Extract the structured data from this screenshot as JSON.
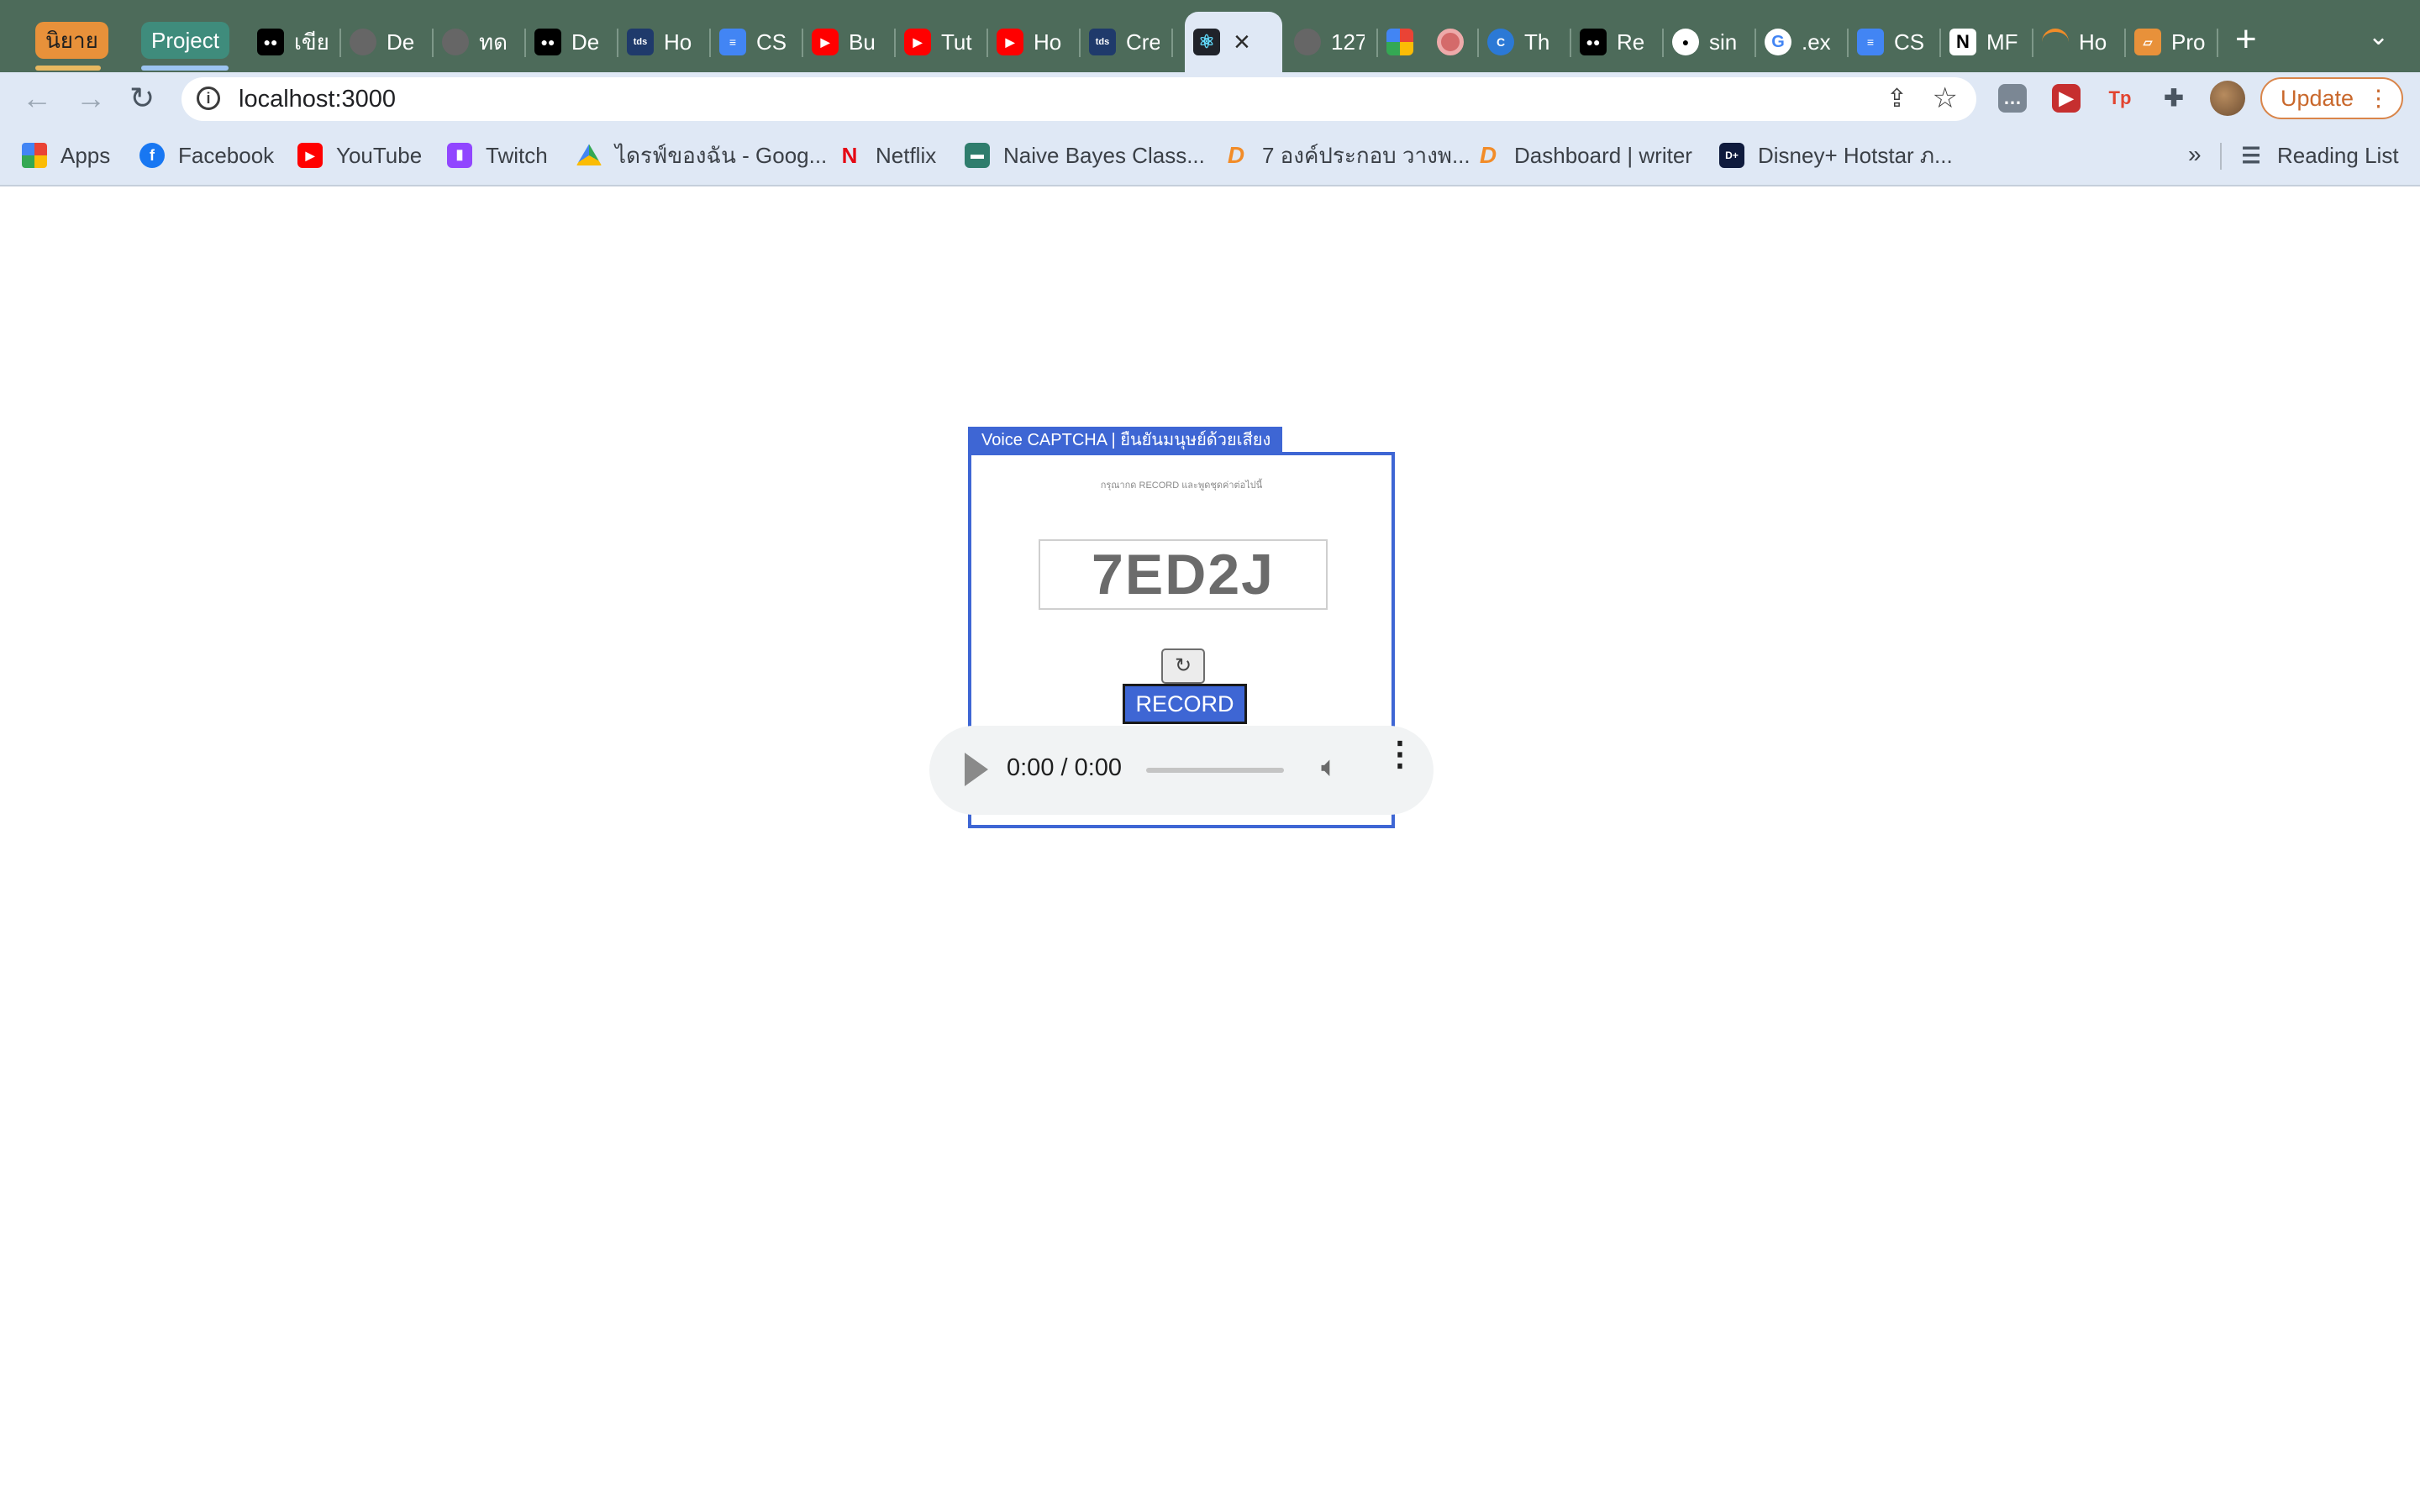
{
  "browser": {
    "tab_groups": [
      {
        "label": "นิยาย",
        "color": "#e8913a"
      },
      {
        "label": "Project",
        "color": "#3f8c7c"
      }
    ],
    "tabs": [
      {
        "title": "เขีย",
        "icon": "medium-icon"
      },
      {
        "title": "De",
        "icon": "globe-icon"
      },
      {
        "title": "ทด",
        "icon": "globe-icon"
      },
      {
        "title": "De",
        "icon": "medium-icon"
      },
      {
        "title": "Ho",
        "icon": "tds-icon"
      },
      {
        "title": "CS",
        "icon": "docs-icon"
      },
      {
        "title": "Bu",
        "icon": "youtube-icon"
      },
      {
        "title": "Tut",
        "icon": "youtube-icon"
      },
      {
        "title": "Ho",
        "icon": "youtube-icon"
      },
      {
        "title": "Cre",
        "icon": "tds-icon"
      },
      {
        "title": "",
        "icon": "react-icon",
        "active": true
      },
      {
        "title": "127",
        "icon": "globe-icon"
      },
      {
        "title": "",
        "icon": "photos-icon"
      },
      {
        "title": "",
        "icon": "record-icon"
      },
      {
        "title": "Th",
        "icon": "canva-icon"
      },
      {
        "title": "Re",
        "icon": "medium-icon"
      },
      {
        "title": "sin",
        "icon": "github-icon"
      },
      {
        "title": ".ex",
        "icon": "google-icon"
      },
      {
        "title": "CS",
        "icon": "docs-icon"
      },
      {
        "title": "MF",
        "icon": "notion-icon"
      },
      {
        "title": "Ho",
        "icon": "orange-arc-icon"
      },
      {
        "title": "Pro",
        "icon": "book-icon"
      }
    ],
    "address": "localhost:3000",
    "update_label": "Update",
    "bookmarks": [
      {
        "label": "Apps",
        "icon": "apps-grid-icon"
      },
      {
        "label": "Facebook",
        "icon": "facebook-icon"
      },
      {
        "label": "YouTube",
        "icon": "youtube-icon"
      },
      {
        "label": "Twitch",
        "icon": "twitch-icon"
      },
      {
        "label": "ไดรฟ์ของฉัน - Goog...",
        "icon": "drive-icon"
      },
      {
        "label": "Netflix",
        "icon": "netflix-icon"
      },
      {
        "label": "Naive Bayes Class...",
        "icon": "sheet-icon"
      },
      {
        "label": "7 องค์ประกอบ วางพ...",
        "icon": "dek-d-icon"
      },
      {
        "label": "Dashboard | writer",
        "icon": "dek-d-icon"
      },
      {
        "label": "Disney+ Hotstar ภ...",
        "icon": "hotstar-icon"
      }
    ],
    "more_bookmarks": "»",
    "reading_list": "Reading List"
  },
  "captcha": {
    "legend": "Voice CAPTCHA | ยืนยันมนุษย์ด้วยเสียง",
    "instruction": "กรุณากด RECORD และพูดชุดค่าต่อไปนี้",
    "code": "7ED2J",
    "refresh_icon": "↻",
    "record_label": "RECORD",
    "audio_time": "0:00 / 0:00"
  },
  "colors": {
    "accent": "#3e66d4",
    "tabstrip": "#4d6b5a",
    "toolbar": "#dfe8f5"
  }
}
